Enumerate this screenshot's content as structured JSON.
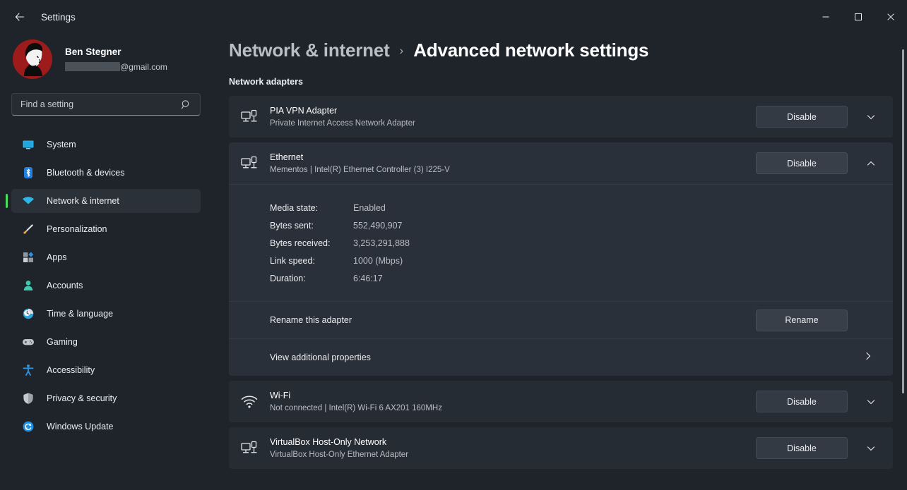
{
  "window": {
    "app_title": "Settings",
    "back_icon": "back-arrow-icon",
    "minimize_icon": "minimize-icon",
    "maximize_icon": "maximize-icon",
    "close_icon": "close-icon"
  },
  "account": {
    "name": "Ben Stegner",
    "email_suffix": "@gmail.com",
    "avatar_icon": "user-avatar"
  },
  "search": {
    "placeholder": "Find a setting",
    "value": "",
    "icon": "search-icon"
  },
  "sidebar": {
    "items": [
      {
        "label": "System",
        "icon": "monitor-icon",
        "active": false
      },
      {
        "label": "Bluetooth & devices",
        "icon": "bluetooth-icon",
        "active": false
      },
      {
        "label": "Network & internet",
        "icon": "wifi-icon",
        "active": true
      },
      {
        "label": "Personalization",
        "icon": "paintbrush-icon",
        "active": false
      },
      {
        "label": "Apps",
        "icon": "apps-grid-icon",
        "active": false
      },
      {
        "label": "Accounts",
        "icon": "person-icon",
        "active": false
      },
      {
        "label": "Time & language",
        "icon": "clock-icon",
        "active": false
      },
      {
        "label": "Gaming",
        "icon": "gamepad-icon",
        "active": false
      },
      {
        "label": "Accessibility",
        "icon": "accessibility-icon",
        "active": false
      },
      {
        "label": "Privacy & security",
        "icon": "shield-icon",
        "active": false
      },
      {
        "label": "Windows Update",
        "icon": "update-refresh-icon",
        "active": false
      }
    ]
  },
  "colors": {
    "accent_green": "#4ade5c",
    "page_background": "#1f242b",
    "card_background": "#262c34",
    "card_expanded_background": "#2a3039",
    "text_primary": "#ffffff",
    "text_secondary": "#b9bdc4"
  },
  "breadcrumb": {
    "parent": "Network & internet",
    "separator": "›",
    "current": "Advanced network settings"
  },
  "main": {
    "section_label": "Network adapters",
    "adapters": [
      {
        "name": "PIA VPN Adapter",
        "subtitle": "Private Internet Access Network Adapter",
        "button_label": "Disable",
        "icon": "network-adapter-icon",
        "expanded": false,
        "chevron": "chevron-down-icon"
      },
      {
        "name": "Ethernet",
        "subtitle": "Mementos | Intel(R) Ethernet Controller (3) I225-V",
        "button_label": "Disable",
        "icon": "network-adapter-icon",
        "expanded": true,
        "chevron": "chevron-up-icon",
        "details": [
          {
            "key": "Media state:",
            "value": "Enabled"
          },
          {
            "key": "Bytes sent:",
            "value": "552,490,907"
          },
          {
            "key": "Bytes received:",
            "value": "3,253,291,888"
          },
          {
            "key": "Link speed:",
            "value": "1000 (Mbps)"
          },
          {
            "key": "Duration:",
            "value": "6:46:17"
          }
        ],
        "rename_label": "Rename this adapter",
        "rename_button": "Rename",
        "properties_label": "View additional properties",
        "properties_chevron": "chevron-right-icon"
      },
      {
        "name": "Wi-Fi",
        "subtitle": "Not connected | Intel(R) Wi-Fi 6 AX201 160MHz",
        "button_label": "Disable",
        "icon": "wifi-signal-icon",
        "expanded": false,
        "chevron": "chevron-down-icon"
      },
      {
        "name": "VirtualBox Host-Only Network",
        "subtitle": "VirtualBox Host-Only Ethernet Adapter",
        "button_label": "Disable",
        "icon": "network-adapter-icon",
        "expanded": false,
        "chevron": "chevron-down-icon"
      }
    ]
  }
}
